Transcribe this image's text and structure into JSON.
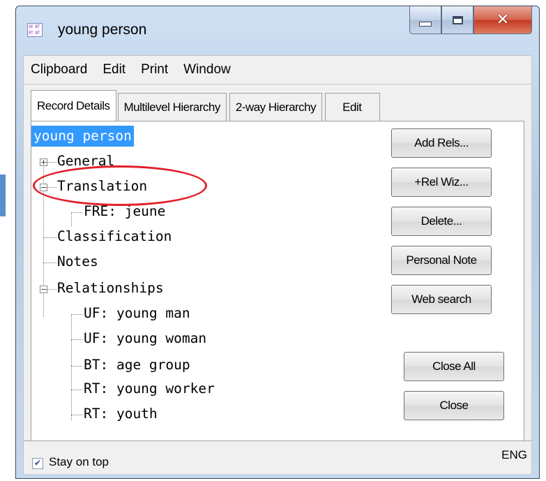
{
  "window": {
    "title": "young person",
    "app_icon_text": "SE BT RT NT"
  },
  "menu": [
    {
      "label": "Clipboard"
    },
    {
      "label": "Edit"
    },
    {
      "label": "Print"
    },
    {
      "label": "Window"
    }
  ],
  "tabs": [
    {
      "label": "Record Details"
    },
    {
      "label": "Multilevel Hierarchy"
    },
    {
      "label": "2-way Hierarchy"
    },
    {
      "label": "Edit"
    }
  ],
  "tree": {
    "root": "young person",
    "nodes": [
      {
        "label": "General",
        "expander": "+"
      },
      {
        "label": "Translation",
        "expander": "−"
      },
      {
        "label": "FRE: jeune"
      },
      {
        "label": "Classification"
      },
      {
        "label": "Notes"
      },
      {
        "label": "Relationships",
        "expander": "−"
      },
      {
        "label": "UF: young man"
      },
      {
        "label": "UF: young woman"
      },
      {
        "label": "BT: age group"
      },
      {
        "label": "RT: young worker"
      },
      {
        "label": "RT: youth"
      }
    ]
  },
  "buttons": {
    "add_rels": "Add Rels...",
    "rel_wiz": "+Rel Wiz...",
    "delete": "Delete...",
    "personal_note": "Personal Note",
    "web_search": "Web search",
    "close_all": "Close All",
    "close": "Close"
  },
  "status": {
    "stay_on_top": "Stay on top",
    "stay_on_top_checked": true,
    "language": "ENG"
  },
  "colors": {
    "selection": "#3399ff",
    "annotation": "#e0202a",
    "window_frame": "#b7cde6"
  }
}
